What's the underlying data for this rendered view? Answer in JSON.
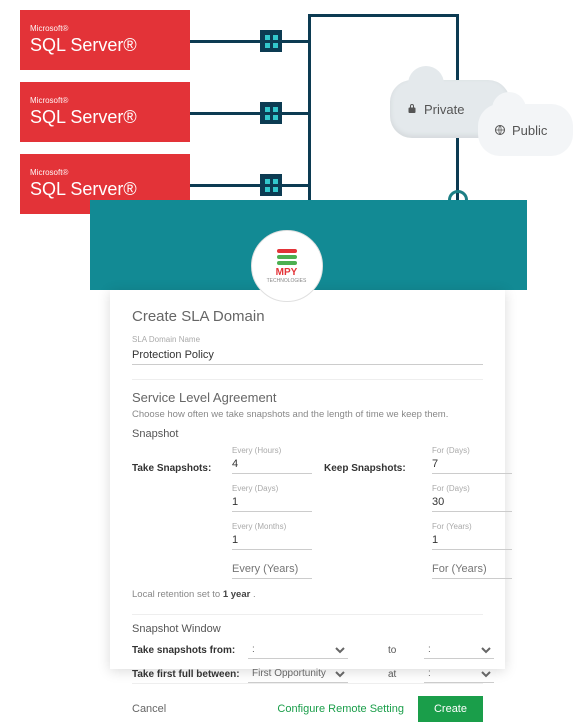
{
  "diagram": {
    "servers": [
      {
        "vendor": "Microsoft®",
        "product": "SQL Server®"
      },
      {
        "vendor": "Microsoft®",
        "product": "SQL Server®"
      },
      {
        "vendor": "Microsoft®",
        "product": "SQL Server®"
      }
    ],
    "clouds": {
      "private": "Private",
      "public": "Public"
    },
    "logo": {
      "name": "MPY",
      "sub": "TECHNOLOGIES"
    }
  },
  "form": {
    "title": "Create SLA Domain",
    "domain_name_label": "SLA Domain Name",
    "domain_name_value": "Protection Policy",
    "sla_heading": "Service Level Agreement",
    "sla_desc": "Choose how often we take snapshots and the length of time we keep them.",
    "snapshot_heading": "Snapshot",
    "take_label": "Take Snapshots:",
    "keep_label": "Keep Snapshots:",
    "rows": [
      {
        "take_unit": "Every (Hours)",
        "take_val": "4",
        "keep_unit": "For (Days)",
        "keep_val": "7"
      },
      {
        "take_unit": "Every (Days)",
        "take_val": "1",
        "keep_unit": "For (Days)",
        "keep_val": "30"
      },
      {
        "take_unit": "Every (Months)",
        "take_val": "1",
        "keep_unit": "For (Years)",
        "keep_val": "1"
      },
      {
        "take_unit": "Every (Years)",
        "take_val": "",
        "keep_unit": "For (Years)",
        "keep_val": ""
      }
    ],
    "retention_text_a": "Local retention set to ",
    "retention_value": "1 year",
    "retention_text_b": " .",
    "window_heading": "Snapshot Window",
    "snap_from_label": "Take snapshots from:",
    "first_full_label": "Take first full between:",
    "first_full_value": "First Opportunity",
    "to": "to",
    "at": "at",
    "colon": ":",
    "cancel": "Cancel",
    "configure": "Configure Remote Setting",
    "create": "Create"
  }
}
